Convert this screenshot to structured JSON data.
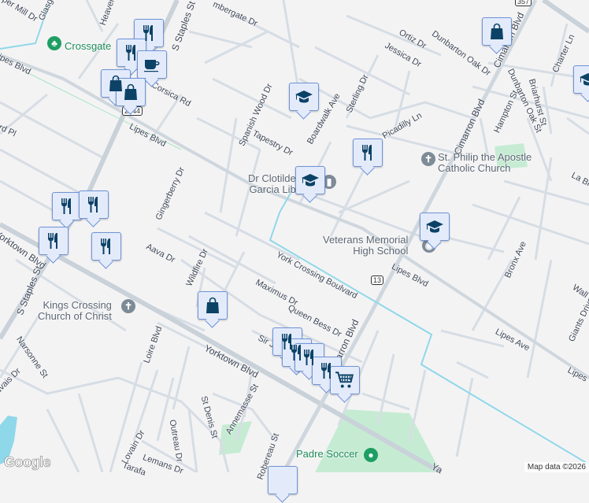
{
  "map": {
    "attribution": "Map data ©2026",
    "logo": "Google",
    "colors": {
      "background": "#f4f3f4",
      "road": "#d4dce3",
      "major_road": "#c9d1d9",
      "water": "#8fd8ea",
      "park": "#c5ecd3",
      "pin_fill": "#e3ebfb",
      "pin_border": "#6f94d8",
      "pin_icon": "#0c4266",
      "park_pin": "#1e9e63",
      "church_pin": "#7d8b97"
    },
    "route_shields": [
      "2444",
      "13",
      "357"
    ],
    "streets": [
      "per Mill Dr",
      "Glasgow",
      "Heaven",
      "S Staples St",
      "mbergate Dr",
      "ipes Blvd",
      "Corsica Rd",
      "Lipes Blvd",
      "Spanish Wood Dr",
      "Tapestry Dr",
      "Boardwalk Ave",
      "Sterling Dr",
      "Ortiz Dr",
      "Jessica Dr",
      "Dunbarton Oak Dr",
      "Cimarron Blvd",
      "Cimarron Blvd",
      "Charter Ln",
      "Hampton St",
      "Dunbarton Oak St",
      "Briarhurst St",
      "Picadilly Ln",
      "La Bi",
      "Gingerberry Dr",
      "rd Pl",
      "York Crossing Boulvard",
      "Lipes Blvd",
      "Bronx Ave",
      "Lipes Ave",
      "Wall St",
      "Giants Drive",
      "Lipes",
      "Aava Dr",
      "Wildfire Dr",
      "Maximus Dr",
      "Queen Bess Dr",
      "Sir J",
      "Cimarron Blvd",
      "Yorktown Blvd",
      "Yorktown Blvd",
      "S Staples St",
      "Narsonne St",
      "uvais Dr",
      "Loire Blvd",
      "Lovain Dr",
      "Outreau Dr",
      "St Denis St",
      "Annemasse St",
      "Lemans Dr",
      "Tarafa",
      "Robereau St",
      "Ya"
    ],
    "places": {
      "crossgate": "Crossgate",
      "library": [
        "Dr Clotilde",
        "Garcia Lib"
      ],
      "church1": [
        "St. Philip the Apostle",
        "Catholic Church"
      ],
      "school": [
        "Veterans Memorial",
        "High School"
      ],
      "church2": [
        "Kings Crossing",
        "Church of Christ"
      ],
      "soccer": "Padre Soccer"
    },
    "markers": [
      "restaurant",
      "restaurant",
      "coffee",
      "shopping",
      "shopping",
      "school",
      "school",
      "restaurant",
      "school",
      "shopping",
      "school",
      "restaurant",
      "restaurant",
      "restaurant",
      "restaurant",
      "shopping",
      "restaurant",
      "restaurant",
      "restaurant",
      "restaurant",
      "grocery"
    ]
  }
}
